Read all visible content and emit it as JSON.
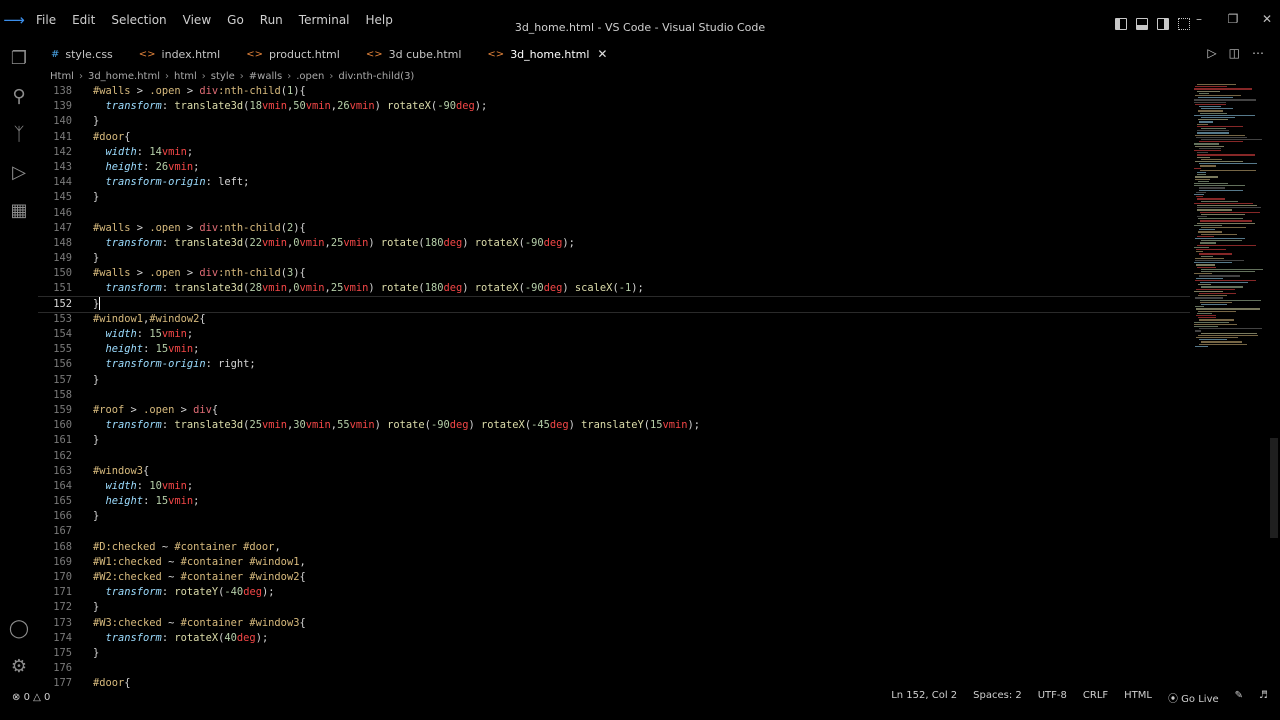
{
  "window": {
    "title": "3d_home.html - VS Code - Visual Studio Code"
  },
  "menu": [
    "File",
    "Edit",
    "Selection",
    "View",
    "Go",
    "Run",
    "Terminal",
    "Help"
  ],
  "tabs": [
    {
      "label": "style.css",
      "icon": "css-file-icon",
      "active": false
    },
    {
      "label": "index.html",
      "icon": "html-file-icon",
      "active": false
    },
    {
      "label": "product.html",
      "icon": "html-file-icon",
      "active": false
    },
    {
      "label": "3d cube.html",
      "icon": "html-file-icon",
      "active": false
    },
    {
      "label": "3d_home.html",
      "icon": "html-file-icon",
      "active": true
    }
  ],
  "breadcrumb": [
    "Html",
    "3d_home.html",
    "html",
    "style",
    "#walls",
    ".open",
    "div:nth-child(3)"
  ],
  "editor": {
    "current_line": 152,
    "lines": [
      {
        "n": "138",
        "tokens": [
          [
            "sel",
            "#walls "
          ],
          [
            "op",
            "> "
          ],
          [
            "sel",
            ".open "
          ],
          [
            "op",
            "> "
          ],
          [
            "tag",
            "div"
          ],
          [
            "sel",
            ":nth-child"
          ],
          [
            "pun",
            "("
          ],
          [
            "num",
            "1"
          ],
          [
            "pun",
            "){"
          ]
        ]
      },
      {
        "n": "139",
        "tokens": [
          [
            "pun",
            "  "
          ],
          [
            "prop",
            "transform"
          ],
          [
            "pun",
            ": "
          ],
          [
            "fn",
            "translate3d"
          ],
          [
            "pun",
            "("
          ],
          [
            "num",
            "18"
          ],
          [
            "unit",
            "vmin"
          ],
          [
            "pun",
            ","
          ],
          [
            "num",
            "50"
          ],
          [
            "unit",
            "vmin"
          ],
          [
            "pun",
            ","
          ],
          [
            "num",
            "26"
          ],
          [
            "unit",
            "vmin"
          ],
          [
            "pun",
            ") "
          ],
          [
            "fn",
            "rotateX"
          ],
          [
            "pun",
            "("
          ],
          [
            "num",
            "-90"
          ],
          [
            "unit",
            "deg"
          ],
          [
            "pun",
            ");"
          ]
        ]
      },
      {
        "n": "140",
        "tokens": [
          [
            "pun",
            "}"
          ]
        ]
      },
      {
        "n": "141",
        "tokens": [
          [
            "sel",
            "#door"
          ],
          [
            "pun",
            "{"
          ]
        ]
      },
      {
        "n": "142",
        "tokens": [
          [
            "pun",
            "  "
          ],
          [
            "prop",
            "width"
          ],
          [
            "pun",
            ": "
          ],
          [
            "num",
            "14"
          ],
          [
            "unit",
            "vmin"
          ],
          [
            "pun",
            ";"
          ]
        ]
      },
      {
        "n": "143",
        "tokens": [
          [
            "pun",
            "  "
          ],
          [
            "prop",
            "height"
          ],
          [
            "pun",
            ": "
          ],
          [
            "num",
            "26"
          ],
          [
            "unit",
            "vmin"
          ],
          [
            "pun",
            ";"
          ]
        ]
      },
      {
        "n": "144",
        "tokens": [
          [
            "pun",
            "  "
          ],
          [
            "prop",
            "transform-origin"
          ],
          [
            "pun",
            ": "
          ],
          [
            "kw",
            "left"
          ],
          [
            "pun",
            ";"
          ]
        ]
      },
      {
        "n": "145",
        "tokens": [
          [
            "pun",
            "}"
          ]
        ]
      },
      {
        "n": "146",
        "tokens": []
      },
      {
        "n": "147",
        "tokens": [
          [
            "sel",
            "#walls "
          ],
          [
            "op",
            "> "
          ],
          [
            "sel",
            ".open "
          ],
          [
            "op",
            "> "
          ],
          [
            "tag",
            "div"
          ],
          [
            "sel",
            ":nth-child"
          ],
          [
            "pun",
            "("
          ],
          [
            "num",
            "2"
          ],
          [
            "pun",
            "){"
          ]
        ]
      },
      {
        "n": "148",
        "tokens": [
          [
            "pun",
            "  "
          ],
          [
            "prop",
            "transform"
          ],
          [
            "pun",
            ": "
          ],
          [
            "fn",
            "translate3d"
          ],
          [
            "pun",
            "("
          ],
          [
            "num",
            "22"
          ],
          [
            "unit",
            "vmin"
          ],
          [
            "pun",
            ","
          ],
          [
            "num",
            "0"
          ],
          [
            "unit",
            "vmin"
          ],
          [
            "pun",
            ","
          ],
          [
            "num",
            "25"
          ],
          [
            "unit",
            "vmin"
          ],
          [
            "pun",
            ") "
          ],
          [
            "fn",
            "rotate"
          ],
          [
            "pun",
            "("
          ],
          [
            "num",
            "180"
          ],
          [
            "unit",
            "deg"
          ],
          [
            "pun",
            ") "
          ],
          [
            "fn",
            "rotateX"
          ],
          [
            "pun",
            "("
          ],
          [
            "num",
            "-90"
          ],
          [
            "unit",
            "deg"
          ],
          [
            "pun",
            ");"
          ]
        ]
      },
      {
        "n": "149",
        "tokens": [
          [
            "pun",
            "}"
          ]
        ]
      },
      {
        "n": "150",
        "tokens": [
          [
            "sel",
            "#walls "
          ],
          [
            "op",
            "> "
          ],
          [
            "sel",
            ".open "
          ],
          [
            "op",
            "> "
          ],
          [
            "tag",
            "div"
          ],
          [
            "sel",
            ":nth-child"
          ],
          [
            "pun",
            "("
          ],
          [
            "num",
            "3"
          ],
          [
            "pun",
            "){"
          ]
        ]
      },
      {
        "n": "151",
        "tokens": [
          [
            "pun",
            "  "
          ],
          [
            "prop",
            "transform"
          ],
          [
            "pun",
            ": "
          ],
          [
            "fn",
            "translate3d"
          ],
          [
            "pun",
            "("
          ],
          [
            "num",
            "28"
          ],
          [
            "unit",
            "vmin"
          ],
          [
            "pun",
            ","
          ],
          [
            "num",
            "0"
          ],
          [
            "unit",
            "vmin"
          ],
          [
            "pun",
            ","
          ],
          [
            "num",
            "25"
          ],
          [
            "unit",
            "vmin"
          ],
          [
            "pun",
            ") "
          ],
          [
            "fn",
            "rotate"
          ],
          [
            "pun",
            "("
          ],
          [
            "num",
            "180"
          ],
          [
            "unit",
            "deg"
          ],
          [
            "pun",
            ") "
          ],
          [
            "fn",
            "rotateX"
          ],
          [
            "pun",
            "("
          ],
          [
            "num",
            "-90"
          ],
          [
            "unit",
            "deg"
          ],
          [
            "pun",
            ") "
          ],
          [
            "fn",
            "scaleX"
          ],
          [
            "pun",
            "("
          ],
          [
            "num",
            "-1"
          ],
          [
            "pun",
            ");"
          ]
        ]
      },
      {
        "n": "152",
        "tokens": [
          [
            "pun",
            "}"
          ]
        ]
      },
      {
        "n": "153",
        "tokens": [
          [
            "sel",
            "#window1"
          ],
          [
            "pun",
            ","
          ],
          [
            "sel",
            "#window2"
          ],
          [
            "pun",
            "{"
          ]
        ]
      },
      {
        "n": "154",
        "tokens": [
          [
            "pun",
            "  "
          ],
          [
            "prop",
            "width"
          ],
          [
            "pun",
            ": "
          ],
          [
            "num",
            "15"
          ],
          [
            "unit",
            "vmin"
          ],
          [
            "pun",
            ";"
          ]
        ]
      },
      {
        "n": "155",
        "tokens": [
          [
            "pun",
            "  "
          ],
          [
            "prop",
            "height"
          ],
          [
            "pun",
            ": "
          ],
          [
            "num",
            "15"
          ],
          [
            "unit",
            "vmin"
          ],
          [
            "pun",
            ";"
          ]
        ]
      },
      {
        "n": "156",
        "tokens": [
          [
            "pun",
            "  "
          ],
          [
            "prop",
            "transform-origin"
          ],
          [
            "pun",
            ": "
          ],
          [
            "kw",
            "right"
          ],
          [
            "pun",
            ";"
          ]
        ]
      },
      {
        "n": "157",
        "tokens": [
          [
            "pun",
            "}"
          ]
        ]
      },
      {
        "n": "158",
        "tokens": []
      },
      {
        "n": "159",
        "tokens": [
          [
            "sel",
            "#roof "
          ],
          [
            "op",
            "> "
          ],
          [
            "sel",
            ".open "
          ],
          [
            "op",
            "> "
          ],
          [
            "tag",
            "div"
          ],
          [
            "pun",
            "{"
          ]
        ]
      },
      {
        "n": "160",
        "tokens": [
          [
            "pun",
            "  "
          ],
          [
            "prop",
            "transform"
          ],
          [
            "pun",
            ": "
          ],
          [
            "fn",
            "translate3d"
          ],
          [
            "pun",
            "("
          ],
          [
            "num",
            "25"
          ],
          [
            "unit",
            "vmin"
          ],
          [
            "pun",
            ","
          ],
          [
            "num",
            "30"
          ],
          [
            "unit",
            "vmin"
          ],
          [
            "pun",
            ","
          ],
          [
            "num",
            "55"
          ],
          [
            "unit",
            "vmin"
          ],
          [
            "pun",
            ") "
          ],
          [
            "fn",
            "rotate"
          ],
          [
            "pun",
            "("
          ],
          [
            "num",
            "-90"
          ],
          [
            "unit",
            "deg"
          ],
          [
            "pun",
            ") "
          ],
          [
            "fn",
            "rotateX"
          ],
          [
            "pun",
            "("
          ],
          [
            "num",
            "-45"
          ],
          [
            "unit",
            "deg"
          ],
          [
            "pun",
            ") "
          ],
          [
            "fn",
            "translateY"
          ],
          [
            "pun",
            "("
          ],
          [
            "num",
            "15"
          ],
          [
            "unit",
            "vmin"
          ],
          [
            "pun",
            ");"
          ]
        ]
      },
      {
        "n": "161",
        "tokens": [
          [
            "pun",
            "}"
          ]
        ]
      },
      {
        "n": "162",
        "tokens": []
      },
      {
        "n": "163",
        "tokens": [
          [
            "sel",
            "#window3"
          ],
          [
            "pun",
            "{"
          ]
        ]
      },
      {
        "n": "164",
        "tokens": [
          [
            "pun",
            "  "
          ],
          [
            "prop",
            "width"
          ],
          [
            "pun",
            ": "
          ],
          [
            "num",
            "10"
          ],
          [
            "unit",
            "vmin"
          ],
          [
            "pun",
            ";"
          ]
        ]
      },
      {
        "n": "165",
        "tokens": [
          [
            "pun",
            "  "
          ],
          [
            "prop",
            "height"
          ],
          [
            "pun",
            ": "
          ],
          [
            "num",
            "15"
          ],
          [
            "unit",
            "vmin"
          ],
          [
            "pun",
            ";"
          ]
        ]
      },
      {
        "n": "166",
        "tokens": [
          [
            "pun",
            "}"
          ]
        ]
      },
      {
        "n": "167",
        "tokens": []
      },
      {
        "n": "168",
        "tokens": [
          [
            "sel",
            "#D:checked "
          ],
          [
            "op",
            "~ "
          ],
          [
            "sel",
            "#container #door"
          ],
          [
            "pun",
            ","
          ]
        ]
      },
      {
        "n": "169",
        "tokens": [
          [
            "sel",
            "#W1:checked "
          ],
          [
            "op",
            "~ "
          ],
          [
            "sel",
            "#container #window1"
          ],
          [
            "pun",
            ","
          ]
        ]
      },
      {
        "n": "170",
        "tokens": [
          [
            "sel",
            "#W2:checked "
          ],
          [
            "op",
            "~ "
          ],
          [
            "sel",
            "#container #window2"
          ],
          [
            "pun",
            "{"
          ]
        ]
      },
      {
        "n": "171",
        "tokens": [
          [
            "pun",
            "  "
          ],
          [
            "prop",
            "transform"
          ],
          [
            "pun",
            ": "
          ],
          [
            "fn",
            "rotateY"
          ],
          [
            "pun",
            "("
          ],
          [
            "num",
            "-40"
          ],
          [
            "unit",
            "deg"
          ],
          [
            "pun",
            ");"
          ]
        ]
      },
      {
        "n": "172",
        "tokens": [
          [
            "pun",
            "}"
          ]
        ]
      },
      {
        "n": "173",
        "tokens": [
          [
            "sel",
            "#W3:checked "
          ],
          [
            "op",
            "~ "
          ],
          [
            "sel",
            "#container #window3"
          ],
          [
            "pun",
            "{"
          ]
        ]
      },
      {
        "n": "174",
        "tokens": [
          [
            "pun",
            "  "
          ],
          [
            "prop",
            "transform"
          ],
          [
            "pun",
            ": "
          ],
          [
            "fn",
            "rotateX"
          ],
          [
            "pun",
            "("
          ],
          [
            "num",
            "40"
          ],
          [
            "unit",
            "deg"
          ],
          [
            "pun",
            ");"
          ]
        ]
      },
      {
        "n": "175",
        "tokens": [
          [
            "pun",
            "}"
          ]
        ]
      },
      {
        "n": "176",
        "tokens": []
      },
      {
        "n": "177",
        "tokens": [
          [
            "sel",
            "#door"
          ],
          [
            "pun",
            "{"
          ]
        ]
      }
    ]
  },
  "status": {
    "errors": "0",
    "warnings": "0",
    "position": "Ln 152, Col 2",
    "spaces": "Spaces: 2",
    "encoding": "UTF-8",
    "eol": "CRLF",
    "language": "HTML",
    "golive": "Go Live"
  },
  "colors": {
    "background": "#000000",
    "selector": "#d7ba7d",
    "property": "#9cdcfe",
    "function": "#dcdcaa",
    "number": "#b5cea8",
    "unit": "#f44747",
    "accent": "#3b8eea"
  }
}
